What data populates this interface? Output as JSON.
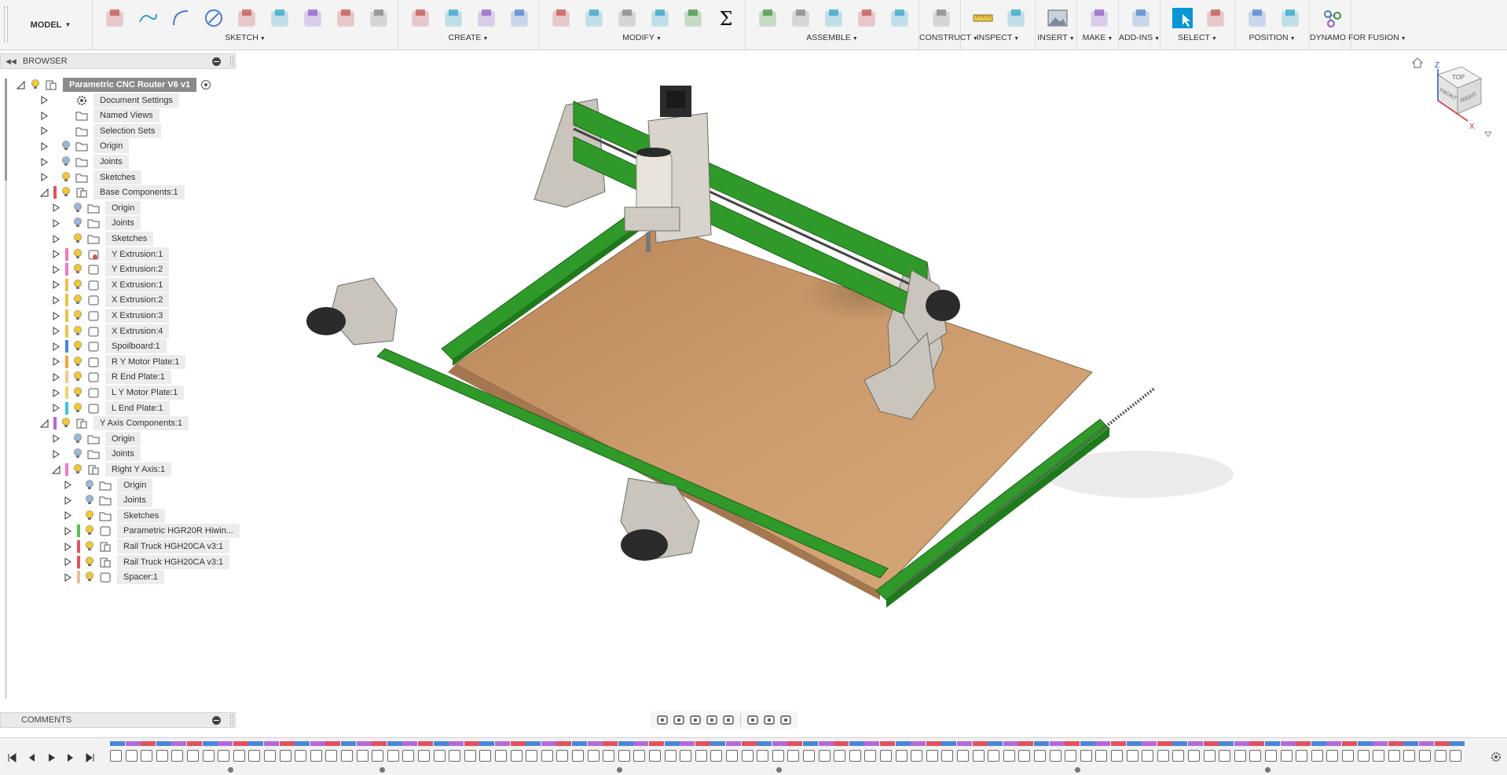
{
  "toolbar": {
    "workspace": "MODEL",
    "groups": [
      {
        "id": "sketch",
        "label": "SKETCH",
        "icons": [
          "sketch-create-icon",
          "line-icon",
          "arc-icon",
          "circle-icon",
          "mirror-icon",
          "pattern-icon",
          "project-icon",
          "rectangle-icon",
          "finish-sketch-icon"
        ]
      },
      {
        "id": "create",
        "label": "CREATE",
        "icons": [
          "extrude-icon",
          "form-icon",
          "sweep-pattern-icon",
          "new-component-icon"
        ]
      },
      {
        "id": "modify",
        "label": "MODIFY",
        "icons": [
          "press-pull-icon",
          "fillet-icon",
          "shell-icon",
          "chamfer-icon",
          "combine-icon",
          "parameters-sigma-icon"
        ]
      },
      {
        "id": "assemble",
        "label": "ASSEMBLE",
        "icons": [
          "new-component-assemble-icon",
          "joint-icon",
          "as-built-joint-icon",
          "rigid-group-icon",
          "drive-joints-icon"
        ]
      },
      {
        "id": "construct",
        "label": "CONSTRUCT",
        "icons": [
          "offset-plane-icon"
        ]
      },
      {
        "id": "inspect",
        "label": "INSPECT",
        "icons": [
          "measure-icon",
          "section-analysis-icon"
        ]
      },
      {
        "id": "insert",
        "label": "INSERT",
        "icons": [
          "insert-image-icon"
        ]
      },
      {
        "id": "make",
        "label": "MAKE",
        "icons": [
          "3d-print-icon"
        ]
      },
      {
        "id": "addins",
        "label": "ADD-INS",
        "icons": [
          "scripts-icon"
        ]
      },
      {
        "id": "select",
        "label": "SELECT",
        "icons": [
          "select-cursor-icon",
          "selection-filter-icon"
        ]
      },
      {
        "id": "position",
        "label": "POSITION",
        "icons": [
          "capture-position-icon",
          "revert-position-icon"
        ]
      },
      {
        "id": "dynamo",
        "label": "DYNAMO FOR FUSION",
        "icons": [
          "dynamo-icon"
        ]
      }
    ]
  },
  "browser": {
    "title": "BROWSER",
    "items": [
      {
        "label": "Parametric CNC Router V6 v1",
        "level": 0,
        "expanded": true,
        "root": true,
        "icon": "component-icon",
        "bulb": "yellow",
        "color": ""
      },
      {
        "label": "Document Settings",
        "level": 1,
        "icon": "gear-icon",
        "bulb": "none",
        "color": ""
      },
      {
        "label": "Named Views",
        "level": 1,
        "icon": "folder-icon",
        "bulb": "none",
        "color": ""
      },
      {
        "label": "Selection Sets",
        "level": 1,
        "icon": "folder-icon",
        "bulb": "none",
        "color": ""
      },
      {
        "label": "Origin",
        "level": 1,
        "icon": "folder-icon",
        "bulb": "blue",
        "color": ""
      },
      {
        "label": "Joints",
        "level": 1,
        "icon": "folder-icon",
        "bulb": "blue",
        "color": ""
      },
      {
        "label": "Sketches",
        "level": 1,
        "icon": "folder-icon",
        "bulb": "yellow",
        "color": ""
      },
      {
        "label": "Base Components:1",
        "level": 1,
        "expanded": true,
        "icon": "component-icon",
        "bulb": "yellow",
        "color": "#e0525f"
      },
      {
        "label": "Origin",
        "level": 2,
        "icon": "folder-icon",
        "bulb": "blue",
        "color": ""
      },
      {
        "label": "Joints",
        "level": 2,
        "icon": "folder-icon",
        "bulb": "blue",
        "color": ""
      },
      {
        "label": "Sketches",
        "level": 2,
        "icon": "folder-icon",
        "bulb": "yellow",
        "color": ""
      },
      {
        "label": "Y Extrusion:1",
        "level": 2,
        "icon": "body-link-icon",
        "bulb": "yellow",
        "color": "#f07ac4"
      },
      {
        "label": "Y Extrusion:2",
        "level": 2,
        "icon": "body-icon",
        "bulb": "yellow",
        "color": "#f07ac4"
      },
      {
        "label": "X Extrusion:1",
        "level": 2,
        "icon": "body-icon",
        "bulb": "yellow",
        "color": "#e8c34a"
      },
      {
        "label": "X Extrusion:2",
        "level": 2,
        "icon": "body-icon",
        "bulb": "yellow",
        "color": "#e8c34a"
      },
      {
        "label": "X Extrusion:3",
        "level": 2,
        "icon": "body-icon",
        "bulb": "yellow",
        "color": "#e8c34a"
      },
      {
        "label": "X Extrusion:4",
        "level": 2,
        "icon": "body-icon",
        "bulb": "yellow",
        "color": "#e8c34a"
      },
      {
        "label": "Spoilboard:1",
        "level": 2,
        "icon": "body-icon",
        "bulb": "yellow",
        "color": "#4a86d8"
      },
      {
        "label": "R Y Motor Plate:1",
        "level": 2,
        "icon": "body-icon",
        "bulb": "yellow",
        "color": "#f2a43c"
      },
      {
        "label": "R End Plate:1",
        "level": 2,
        "icon": "body-icon",
        "bulb": "yellow",
        "color": "#f5c88a"
      },
      {
        "label": "L Y Motor Plate:1",
        "level": 2,
        "icon": "body-icon",
        "bulb": "yellow",
        "color": "#f5d26a"
      },
      {
        "label": "L End Plate:1",
        "level": 2,
        "icon": "body-icon",
        "bulb": "yellow",
        "color": "#3fc3d8"
      },
      {
        "label": "Y Axis Components:1",
        "level": 1,
        "expanded": true,
        "icon": "component-icon",
        "bulb": "yellow",
        "color": "#b36ad9"
      },
      {
        "label": "Origin",
        "level": 2,
        "icon": "folder-icon",
        "bulb": "blue",
        "color": ""
      },
      {
        "label": "Joints",
        "level": 2,
        "icon": "folder-icon",
        "bulb": "blue",
        "color": ""
      },
      {
        "label": "Right Y Axis:1",
        "level": 2,
        "expanded": true,
        "icon": "component-icon",
        "bulb": "yellow",
        "color": "#f07ac4"
      },
      {
        "label": "Origin",
        "level": 3,
        "icon": "folder-icon",
        "bulb": "blue",
        "color": ""
      },
      {
        "label": "Joints",
        "level": 3,
        "icon": "folder-icon",
        "bulb": "blue",
        "color": ""
      },
      {
        "label": "Sketches",
        "level": 3,
        "icon": "folder-icon",
        "bulb": "yellow",
        "color": ""
      },
      {
        "label": "Parametric HGR20R Hiwin...",
        "level": 3,
        "icon": "body-icon",
        "bulb": "yellow",
        "color": "#58c24a"
      },
      {
        "label": "Rail Truck HGH20CA v3:1",
        "level": 3,
        "icon": "component-icon",
        "bulb": "yellow",
        "color": "#e0525f"
      },
      {
        "label": "Rail Truck HGH20CA v3:1",
        "level": 3,
        "icon": "component-icon",
        "bulb": "yellow",
        "color": "#e0525f"
      },
      {
        "label": "Spacer:1",
        "level": 3,
        "icon": "body-icon",
        "bulb": "yellow",
        "color": "#f5b89a"
      }
    ]
  },
  "comments": {
    "title": "COMMENTS"
  },
  "viewcube": {
    "top": "TOP",
    "front": "FRONT",
    "right": "RIGHT",
    "axis_x": "X",
    "axis_z": "Z"
  },
  "navbar": {
    "icons": [
      "orbit-icon",
      "look-at-icon",
      "pan-icon",
      "zoom-window-icon",
      "zoom-icon",
      "display-settings-icon",
      "grid-icon",
      "viewports-icon"
    ]
  },
  "timeline": {
    "controls": [
      "go-to-start-icon",
      "step-back-icon",
      "play-icon",
      "step-forward-icon",
      "go-to-end-icon"
    ],
    "band_colors": [
      "#4a86d8",
      "#b36ad9",
      "#e0525f",
      "#f07ac4",
      "#f5b89a",
      "#58c24a",
      "#ffffff"
    ]
  },
  "colors": {
    "accent": "#0696d7",
    "extrusion_green": "#2f9a2a",
    "spoilboard": "#c9986a"
  }
}
